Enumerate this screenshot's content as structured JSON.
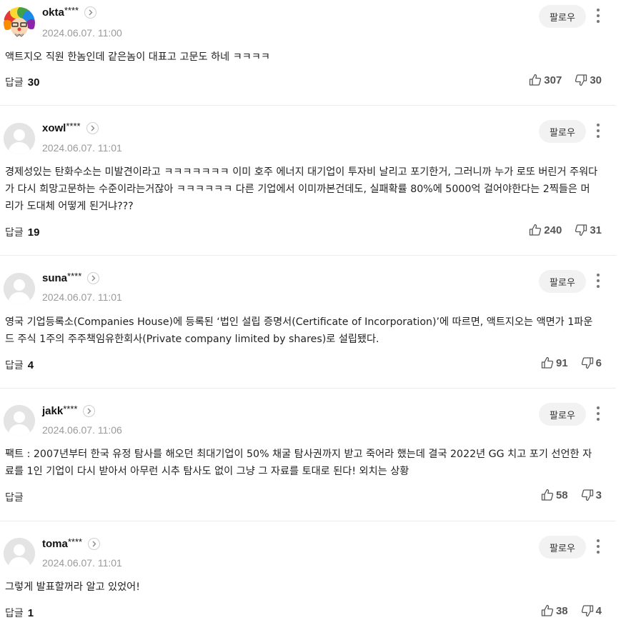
{
  "follow_label": "팔로우",
  "reply_label": "답글",
  "comments": [
    {
      "nickname": "okta",
      "stars": "****",
      "date": "2024.06.07. 11:00",
      "text": "액트지오 직원 한놈인데 같은놈이 대표고 고문도 하네 ㅋㅋㅋㅋ",
      "reply_count": "30",
      "likes": "307",
      "dislikes": "30",
      "avatar": "rainbow-clown"
    },
    {
      "nickname": "xowl",
      "stars": "****",
      "date": "2024.06.07. 11:01",
      "text": "경제성있는 탄화수소는 미발견이라고 ㅋㅋㅋㅋㅋㅋㅋ 이미 호주 에너지 대기업이 투자비 날리고 포기한거, 그러니까 누가 로또 버린거 주워다가 다시 희망고문하는 수준이라는거잖아 ㅋㅋㅋㅋㅋㅋ 다른 기업에서 이미까본건데도, 실패확률 80%에 5000억 걸어야한다는 2찍들은 머리가 도대체 어떻게 된거냐???",
      "reply_count": "19",
      "likes": "240",
      "dislikes": "31",
      "avatar": "default"
    },
    {
      "nickname": "suna",
      "stars": "****",
      "date": "2024.06.07. 11:01",
      "text": "영국 기업등록소(Companies House)에 등록된 ‘법인 설립 증명서(Certificate of Incorporation)’에 따르면, 액트지오는 액면가 1파운드 주식 1주의 주주책임유한회사(Private company limited by shares)로 설립됐다.",
      "reply_count": "4",
      "likes": "91",
      "dislikes": "6",
      "avatar": "default"
    },
    {
      "nickname": "jakk",
      "stars": "****",
      "date": "2024.06.07. 11:06",
      "text": "팩트 : 2007년부터 한국 유정 탐사를 해오던 최대기업이 50% 채굴 탐사권까지 받고 죽어라 했는데 결국 2022년 GG 치고 포기 선언한 자료를 1인 기업이 다시 받아서 아무런 시추 탐사도 없이 그냥 그 자료를 토대로 된다! 외치는 상황",
      "reply_count": "",
      "likes": "58",
      "dislikes": "3",
      "avatar": "default"
    },
    {
      "nickname": "toma",
      "stars": "****",
      "date": "2024.06.07. 11:01",
      "text": "그렇게 발표할꺼라 알고 있었어!",
      "reply_count": "1",
      "likes": "38",
      "dislikes": "4",
      "avatar": "default"
    }
  ]
}
